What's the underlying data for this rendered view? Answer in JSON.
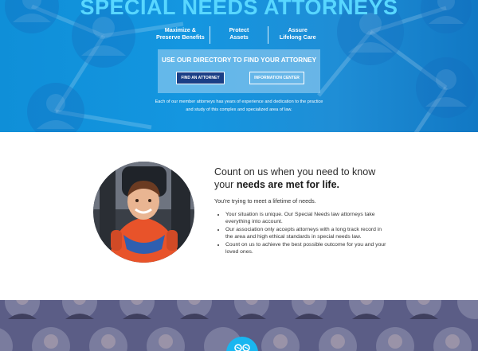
{
  "hero": {
    "title": "SPECIAL NEEDS ATTORNEYS",
    "benefits": [
      {
        "line1": "Maximize &",
        "line2": "Preserve Benefits"
      },
      {
        "line1": "Protect",
        "line2": "Assets"
      },
      {
        "line1": "Assure",
        "line2": "Lifelong Care"
      }
    ],
    "directory": {
      "title": "USE OUR DIRECTORY TO FIND YOUR ATTORNEY",
      "find_button": "FIND AN ATTORNEY",
      "info_button": "INFORMATION CENTER"
    },
    "description": "Each of our member attorneys has years of experience and dedication to the practice and study of this complex and specialized area of law."
  },
  "intro": {
    "headline_plain": "Count on us when you need to know your",
    "headline_bold": "needs are met for life.",
    "subheading": "You're trying to meet a lifetime of needs.",
    "bullets": [
      "Your situation is unique. Our Special Needs law attorneys take everything into account.",
      "Our association only accepts attorneys with a long track record in the area and high ethical standards in special needs law.",
      "Count on us to achieve the best possible outcome for you and your loved ones."
    ]
  },
  "colors": {
    "hero_blue": "#1496e0",
    "title_cyan": "#58d7ff",
    "find_button_navy": "#1b3f86",
    "chat_button": "#19b6f0",
    "bottom_overlay": "#5b5d86"
  },
  "icons": {
    "chat": "chat-icon",
    "hero_background": "people-network-icon"
  }
}
